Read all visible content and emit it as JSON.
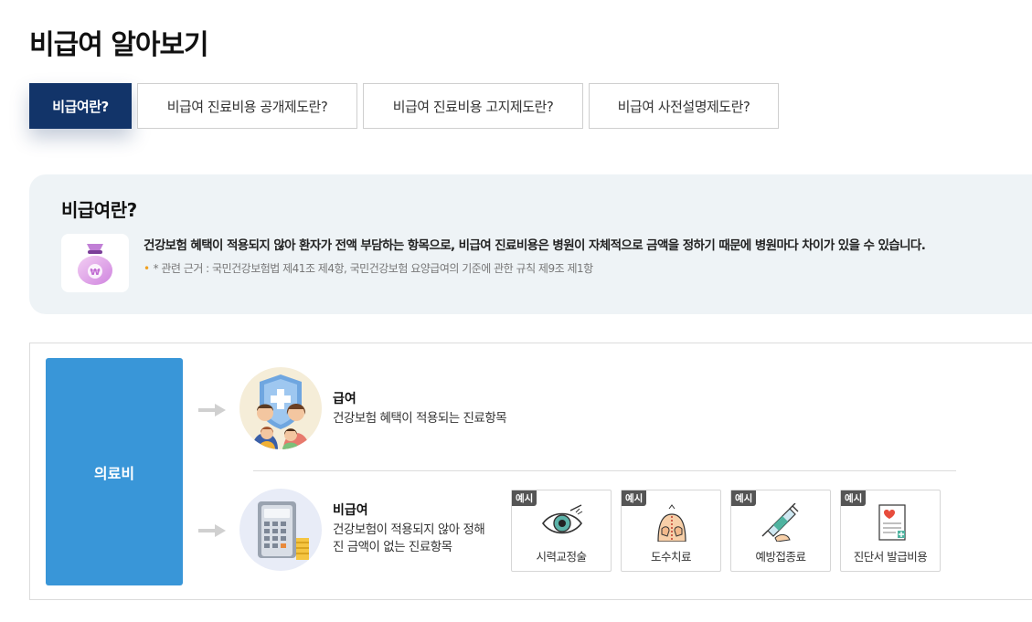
{
  "page": {
    "title": "비급여 알아보기"
  },
  "tabs": [
    {
      "label": "비급여란?",
      "active": true
    },
    {
      "label": "비급여 진료비용 공개제도란?",
      "active": false
    },
    {
      "label": "비급여 진료비용 고지제도란?",
      "active": false
    },
    {
      "label": "비급여 사전설명제도란?",
      "active": false
    }
  ],
  "info": {
    "title": "비급여란?",
    "icon": "money-bag-icon",
    "description": "건강보험 혜택이 적용되지 않아 환자가 전액 부담하는 항목으로, 비급여 진료비용은 병원이 자체적으로 금액을 정하기 때문에 병원마다 차이가 있을 수 있습니다.",
    "reference": "* 관련 근거 : 국민건강보험법 제41조 제4항, 국민건강보험 요양급여의 기준에 관한 규칙 제9조 제1항"
  },
  "diagram": {
    "root_label": "의료비",
    "covered": {
      "title": "급여",
      "description": "건강보험 혜택이 적용되는 진료항목"
    },
    "non_covered": {
      "title": "비급여",
      "description": "건강보험이 적용되지 않아 정해진 금액이 없는 진료항목"
    },
    "example_badge": "예시",
    "examples": [
      {
        "label": "시력교정술",
        "icon": "eye-icon"
      },
      {
        "label": "도수치료",
        "icon": "manual-therapy-icon"
      },
      {
        "label": "예방접종료",
        "icon": "syringe-icon"
      },
      {
        "label": "진단서 발급비용",
        "icon": "document-icon"
      }
    ]
  },
  "colors": {
    "tab_active": "#123469",
    "medical_box": "#3996d8",
    "info_bg": "#eef3f6"
  }
}
